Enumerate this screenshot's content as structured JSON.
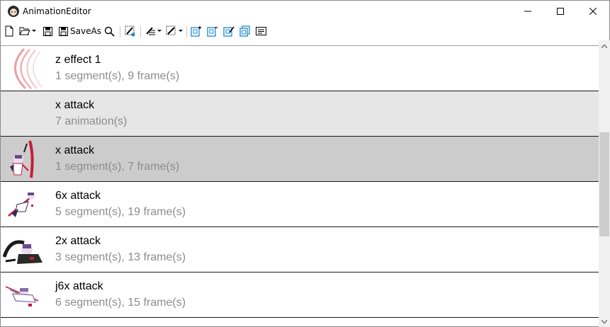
{
  "window": {
    "title": "AnimationEditor"
  },
  "toolbar": {
    "saveas_label": "SaveAs"
  },
  "list": {
    "items": [
      {
        "name": "z effect 1",
        "desc": "1 segment(s), 9 frame(s)",
        "thumb": "slash-effect-thumb",
        "state": "normal"
      },
      {
        "name": "x attack",
        "desc": "7 animation(s)",
        "thumb": "none",
        "state": "group"
      },
      {
        "name": "x attack",
        "desc": "1 segment(s), 7 frame(s)",
        "thumb": "character-thumb",
        "state": "selected"
      },
      {
        "name": "6x attack",
        "desc": "5 segment(s), 19 frame(s)",
        "thumb": "character-thumb",
        "state": "normal"
      },
      {
        "name": "2x attack",
        "desc": "3 segment(s), 13 frame(s)",
        "thumb": "character-thumb",
        "state": "normal"
      },
      {
        "name": "j6x attack",
        "desc": "6 segment(s), 15 frame(s)",
        "thumb": "character-thumb",
        "state": "normal"
      }
    ]
  },
  "colors": {
    "selected_row": "#cccccc",
    "group_row": "#e6e6e6",
    "desc_text": "#8c8c8c",
    "toolbar_accent": "#1e88c8"
  }
}
